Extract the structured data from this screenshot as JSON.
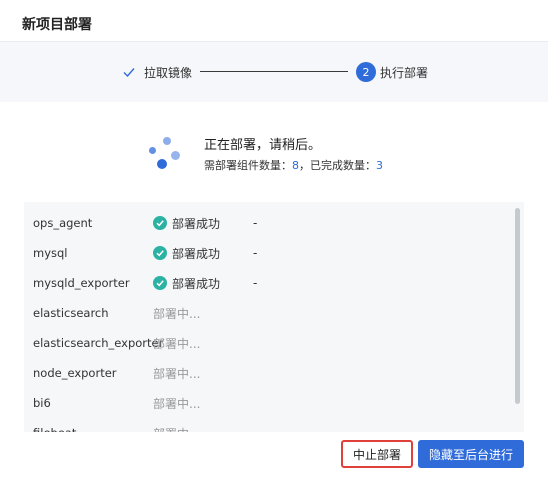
{
  "dialog": {
    "title": "新项目部署"
  },
  "steps": [
    {
      "label": "拉取镜像",
      "state": "done",
      "icon": "check-icon"
    },
    {
      "number": "2",
      "label": "执行部署",
      "state": "active"
    }
  ],
  "status": {
    "main": "正在部署，请稍后。",
    "sub_prefix": "需部署组件数量：",
    "total": "8",
    "sub_mid": "，已完成数量：",
    "done": "3"
  },
  "components": [
    {
      "name": "ops_agent",
      "status": "部署成功",
      "state": "success",
      "extra": "-"
    },
    {
      "name": "mysql",
      "status": "部署成功",
      "state": "success",
      "extra": "-"
    },
    {
      "name": "mysqld_exporter",
      "status": "部署成功",
      "state": "success",
      "extra": "-"
    },
    {
      "name": "elasticsearch",
      "status": "部署中...",
      "state": "pending",
      "extra": ""
    },
    {
      "name": "elasticsearch_exporter",
      "status": "部署中...",
      "state": "pending",
      "extra": ""
    },
    {
      "name": "node_exporter",
      "status": "部署中...",
      "state": "pending",
      "extra": ""
    },
    {
      "name": "bi6",
      "status": "部署中...",
      "state": "pending",
      "extra": ""
    },
    {
      "name": "filebeat",
      "status": "部署中...",
      "state": "pending",
      "extra": ""
    }
  ],
  "buttons": {
    "stop": "中止部署",
    "hide": "隐藏至后台进行"
  },
  "colors": {
    "primary": "#2f6bd9",
    "success": "#2bb2a3",
    "danger": "#e0403a"
  }
}
